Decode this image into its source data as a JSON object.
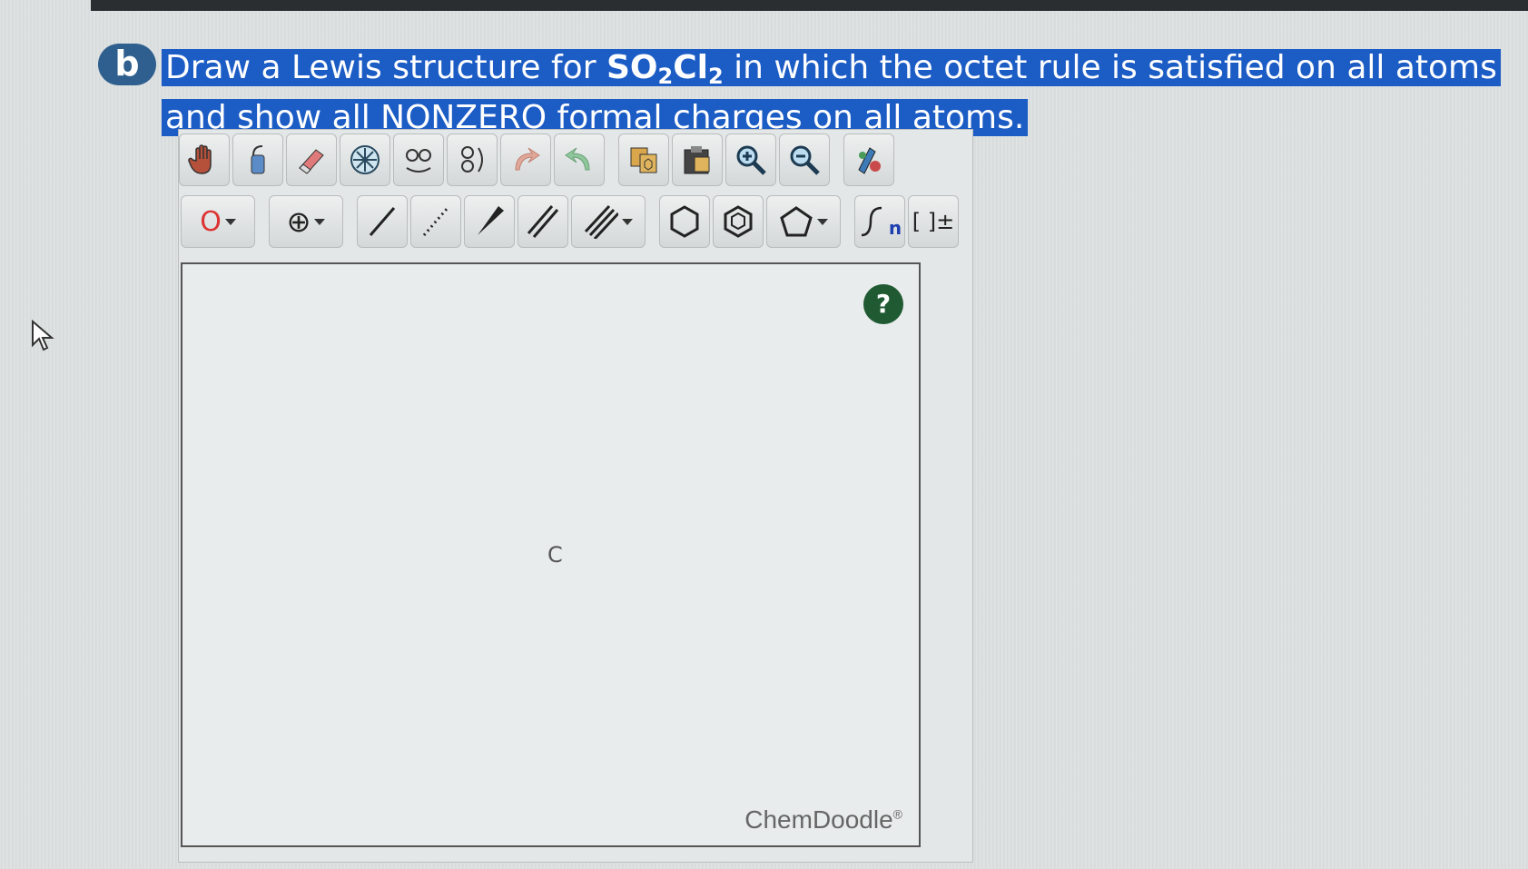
{
  "question": {
    "part_letter": "b",
    "prefix": "Draw a Lewis structure for ",
    "formula_s": "SO",
    "formula_sub1": "2",
    "formula_cl": "Cl",
    "formula_sub2": "2",
    "suffix": " in which the octet rule is satisfied on all atoms and show all NONZERO formal charges on all atoms."
  },
  "toolbar": {
    "row1": [
      "hand-icon",
      "lasso-icon",
      "eraser-icon",
      "center-icon",
      "flip-h-icon",
      "flip-v-icon",
      "undo-icon",
      "redo-icon",
      "copy-icon",
      "paste-icon",
      "zoom-in-icon",
      "zoom-out-icon",
      "clean-icon"
    ],
    "atom_label": "O",
    "charge_label": "⊕",
    "repeat_label": "n",
    "bracket_label": "[ ]±"
  },
  "canvas": {
    "atom_label": "C",
    "help_label": "?",
    "brand": "ChemDoodle",
    "brand_mark": "®"
  },
  "colors": {
    "highlight": "#1c5cc5",
    "badge": "#2f5f8e",
    "help": "#1f5a32"
  }
}
